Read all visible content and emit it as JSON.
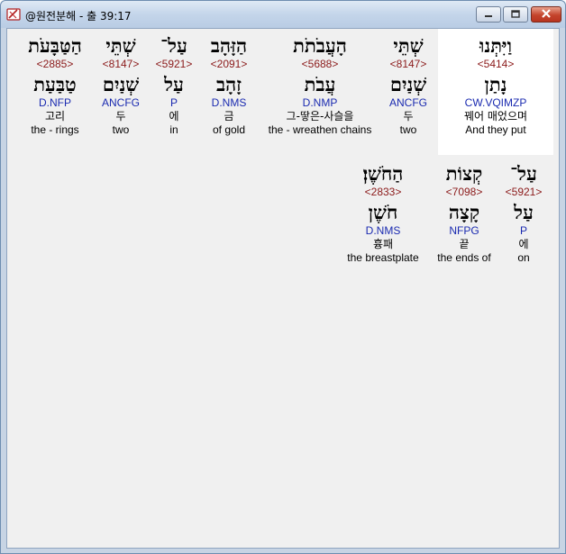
{
  "window": {
    "title": "@원전분해 - 출 39:17"
  },
  "row1": [
    {
      "hebrew": "וַיִּתְּנוּ",
      "strong": "<5414>",
      "lemma": "נָתַן",
      "morph": "CW.VQIMZP",
      "korean": "꿰어 매었으며",
      "english": "And they put"
    },
    {
      "hebrew": "שְׁתֵּי",
      "strong": "<8147>",
      "lemma": "שְׁנַיִם",
      "morph": "ANCFG",
      "korean": "두",
      "english": "two"
    },
    {
      "hebrew": "הָעֲבֹתֹת",
      "strong": "<5688>",
      "lemma": "עֲבֹת",
      "morph": "D.NMP",
      "korean": "그-땋은-사슬을",
      "english": "the - wreathen chains"
    },
    {
      "hebrew": "הַזָּהָב",
      "strong": "<2091>",
      "lemma": "זָהָב",
      "morph": "D.NMS",
      "korean": "금",
      "english": "of gold"
    },
    {
      "hebrew": "עַל־",
      "strong": "<5921>",
      "lemma": "עַל",
      "morph": "P",
      "korean": "에",
      "english": "in"
    },
    {
      "hebrew": "שְׁתֵּי",
      "strong": "<8147>",
      "lemma": "שְׁנַיִם",
      "morph": "ANCFG",
      "korean": "두",
      "english": "two"
    },
    {
      "hebrew": "הַטַּבָּעֹת",
      "strong": "<2885>",
      "lemma": "טַבַּעַת",
      "morph": "D.NFP",
      "korean": "고리",
      "english": "the - rings"
    }
  ],
  "row2": [
    {
      "hebrew": "עַל־",
      "strong": "<5921>",
      "lemma": "עַל",
      "morph": "P",
      "korean": "에",
      "english": "on"
    },
    {
      "hebrew": "קְצוֹת",
      "strong": "<7098>",
      "lemma": "קָצָה",
      "morph": "NFPG",
      "korean": "끝",
      "english": "the ends of"
    },
    {
      "hebrew": "הַחֹשֶׁן׃",
      "strong": "<2833>",
      "lemma": "חֹשֶׁן",
      "morph": "D.NMS",
      "korean": "흉패",
      "english": "the breastplate"
    }
  ],
  "colors": {
    "strong": "#8b1a1a",
    "morph": "#1a2ab0",
    "highlight": "#ffffff",
    "background": "#f0f0f0"
  },
  "icons": {
    "app": "bible-app-icon",
    "minimize": "minimize-icon",
    "maximize": "maximize-icon",
    "close": "close-icon"
  }
}
